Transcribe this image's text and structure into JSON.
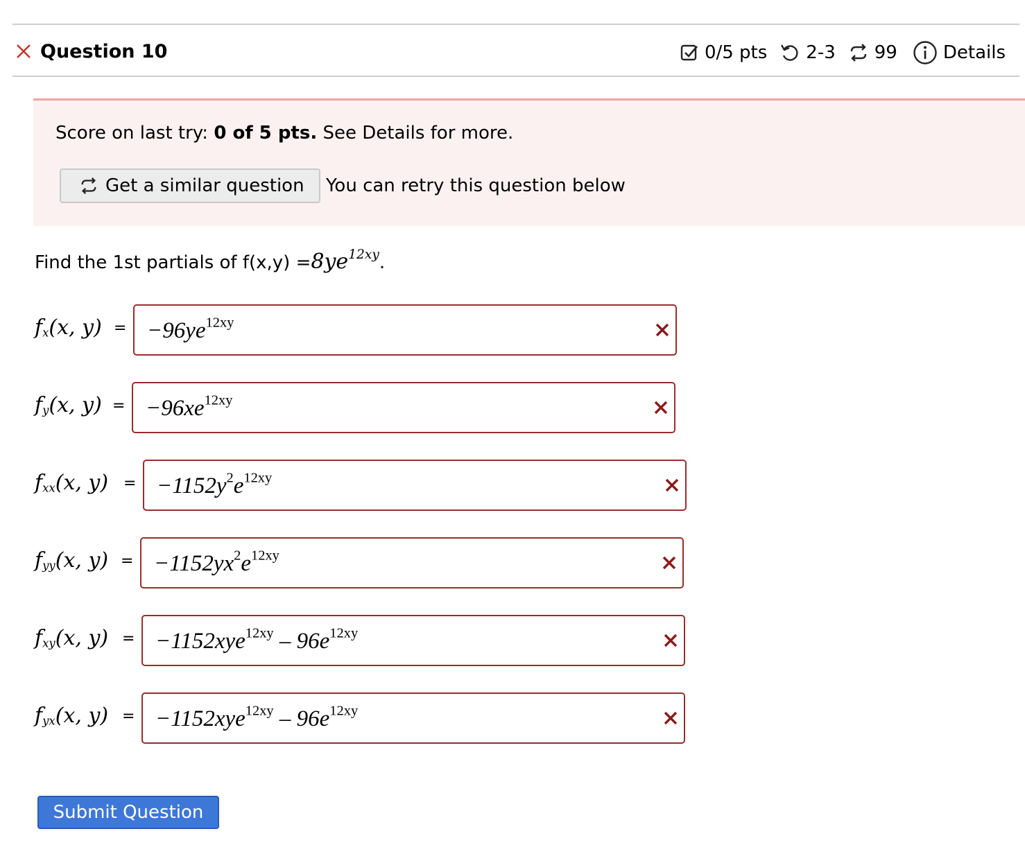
{
  "header": {
    "title": "Question 10",
    "points": "0/5 pts",
    "attempts": "2-3",
    "versions": "99",
    "details_label": "Details"
  },
  "alert": {
    "score_prefix": "Score on last try:",
    "score_value": "0 of 5 pts.",
    "score_suffix": "See Details for more.",
    "similar_button": "Get a similar question",
    "retry_note": "You can retry this question below"
  },
  "question": {
    "prompt_text": "Find the 1st partials of f(x,y) =",
    "function_base": "8ye",
    "function_exponent": "12xy",
    "function_end": "."
  },
  "answers": [
    {
      "label": "f",
      "sub": "x",
      "args": "(x, y)",
      "value": "−96ye",
      "exp": "12xy"
    },
    {
      "label": "f",
      "sub": "y",
      "args": "(x, y)",
      "value": "−96xe",
      "exp": "12xy"
    },
    {
      "label": "f",
      "sub": "xx",
      "args": "(x, y)",
      "value": "−1152y",
      "exp": "2",
      "value2": "e",
      "exp2": "12xy"
    },
    {
      "label": "f",
      "sub": "yy",
      "args": "(x, y)",
      "value": "−1152yx",
      "exp": "2",
      "value2": "e",
      "exp2": "12xy"
    },
    {
      "label": "f",
      "sub": "xy",
      "args": "(x, y)",
      "value": "−1152xye",
      "exp": "12xy",
      "value2": " – 96e",
      "exp2": "12xy"
    },
    {
      "label": "f",
      "sub": "yx",
      "args": "(x, y)",
      "value": "−1152xye",
      "exp": "12xy",
      "value2": " – 96e",
      "exp2": "12xy"
    }
  ],
  "equals_sign": "=",
  "submit_label": "Submit Question",
  "colors": {
    "error": "#9b2c2c",
    "alert_bg": "#fcf1f1",
    "alert_border": "#f1a3a3",
    "button_blue": "#3d78d8"
  }
}
